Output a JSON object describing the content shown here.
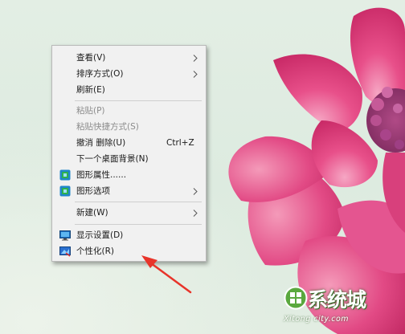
{
  "menu": {
    "items": [
      {
        "label": "查看(V)",
        "submenu": true,
        "disabled": false
      },
      {
        "label": "排序方式(O)",
        "submenu": true,
        "disabled": false
      },
      {
        "label": "刷新(E)",
        "submenu": false,
        "disabled": false
      },
      {
        "label": "粘贴(P)",
        "submenu": false,
        "disabled": true
      },
      {
        "label": "粘贴快捷方式(S)",
        "submenu": false,
        "disabled": true
      },
      {
        "label": "撤消 删除(U)",
        "shortcut": "Ctrl+Z",
        "submenu": false,
        "disabled": false
      },
      {
        "label": "下一个桌面背景(N)",
        "submenu": false,
        "disabled": false
      },
      {
        "label": "图形属性......",
        "icon": "intel-graphics-icon",
        "submenu": false,
        "disabled": false
      },
      {
        "label": "图形选项",
        "icon": "intel-graphics-icon",
        "submenu": true,
        "disabled": false
      },
      {
        "label": "新建(W)",
        "submenu": true,
        "disabled": false
      },
      {
        "label": "显示设置(D)",
        "icon": "display-settings-icon",
        "submenu": false,
        "disabled": false
      },
      {
        "label": "个性化(R)",
        "icon": "personalize-icon",
        "submenu": false,
        "disabled": false
      }
    ]
  },
  "watermark": {
    "brand": "系统城",
    "site": "Xitong city.com"
  },
  "colors": {
    "menu_bg": "#f1f1f1",
    "disabled_text": "#8c8c8c",
    "flower_pink": "#e8508a",
    "annotation_red": "#e8342a"
  }
}
